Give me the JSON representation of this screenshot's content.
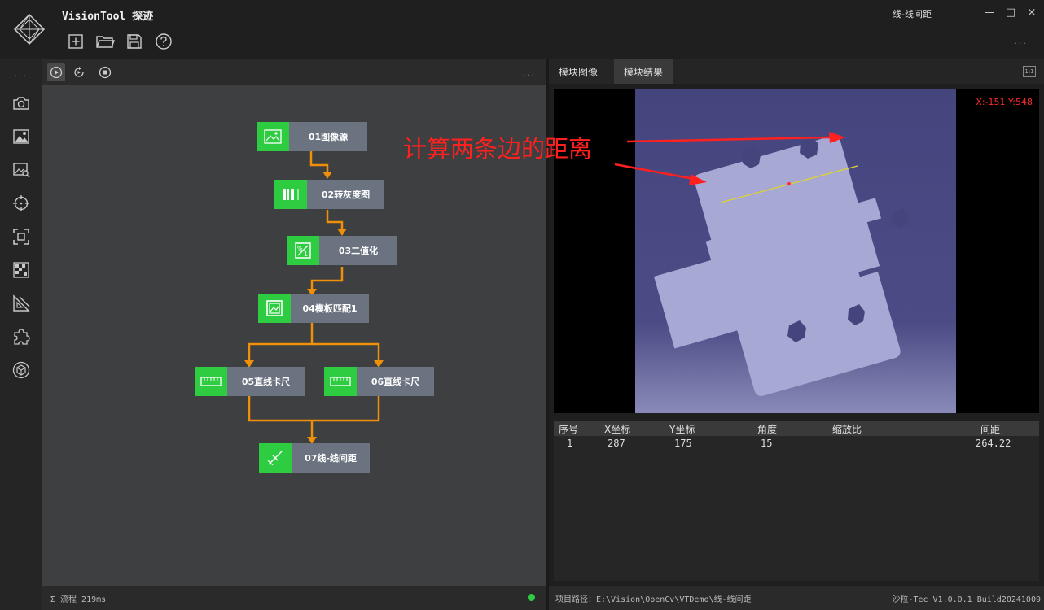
{
  "app": {
    "title": "VisionTool 探迹",
    "window_title": "线-线间距",
    "minimize": "—",
    "maximize": "□",
    "close": "×",
    "more": "...",
    "toolbar": [
      "new-file-icon",
      "open-folder-icon",
      "save-icon",
      "help-icon"
    ]
  },
  "sidebar": {
    "more": "...",
    "icons": [
      "camera-icon",
      "image-icon",
      "image-search-icon",
      "crosshair-icon",
      "focus-frame-icon",
      "pattern-icon",
      "ruler-icon",
      "puzzle-icon",
      "cube-icon"
    ]
  },
  "flow": {
    "more": "...",
    "controls": [
      "run-once-icon",
      "run-loop-icon",
      "stop-icon"
    ],
    "nodes": [
      {
        "label": "01图像源",
        "icon": "image-icon"
      },
      {
        "label": "02转灰度图",
        "icon": "barcode-icon"
      },
      {
        "label": "03二值化",
        "icon": "binarize-icon"
      },
      {
        "label": "04模板匹配1",
        "icon": "template-icon"
      },
      {
        "label": "05直线卡尺",
        "icon": "ruler-icon"
      },
      {
        "label": "06直线卡尺",
        "icon": "ruler-icon"
      },
      {
        "label": "07线-线间距",
        "icon": "line-distance-icon"
      }
    ],
    "status_label": "Σ  流程 219ms",
    "status_color": "#2ecc40"
  },
  "image_view": {
    "tabs": [
      "模块图像",
      "模块结果"
    ],
    "active_tab": 1,
    "fit_label": "1:1",
    "coordinate": "X:-151 Y:548",
    "annotation": "计算两条边的距离"
  },
  "results": {
    "headers": [
      "序号",
      "X坐标",
      "Y坐标",
      "角度",
      "缩放比",
      "间距"
    ],
    "rows": [
      [
        "1",
        "287",
        "175",
        "15",
        "",
        "264.22"
      ]
    ]
  },
  "footer": {
    "path": "项目路径：E:\\Vision\\OpenCv\\VTDemo\\线-线间距",
    "version": "沙粒-Tec V1.0.0.1 Build20241009"
  },
  "colors": {
    "accent_green": "#2ecc40",
    "connector_orange": "#f0900a",
    "node_gray": "#6b7380",
    "annotation_red": "#ff2020"
  }
}
